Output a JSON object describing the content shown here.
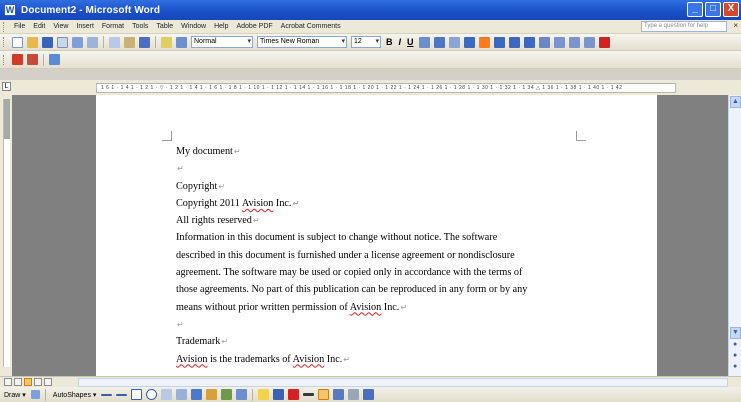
{
  "window": {
    "title": "Document2 - Microsoft Word",
    "app_icon": "W",
    "buttons": {
      "minimize": "_",
      "maximize": "□",
      "close": "X"
    }
  },
  "menubar": {
    "items": [
      "File",
      "Edit",
      "View",
      "Insert",
      "Format",
      "Tools",
      "Table",
      "Window",
      "Help",
      "Adobe PDF",
      "Acrobat Comments"
    ],
    "help_placeholder": "Type a question for help",
    "close_glyph": "×"
  },
  "formatting": {
    "style": "Normal",
    "font": "Times New Roman",
    "size": "12",
    "bold": "B",
    "italic": "I",
    "underline": "U"
  },
  "ruler": {
    "ticks": "1 6 1 · 1 4 1 · 1 2 1 · ▽ · 1 2 1 · 1 4 1 · 1 6 1 · 1 8 1 · 1 10 1 · 1 12 1 · 1 14 1 · 1 16 1 · 1 18 1 · 1 20 1 · 1 22 1 · 1 24 1 · 1 26 1 · 1 28 1 · 1 30 1 · 1 32 1 · 1 34 △ 1 36 1 · 1 38 1 · 1 40 1 · 1 42"
  },
  "document": {
    "para_mark": "↵",
    "lines": [
      "My document",
      "",
      "Copyright",
      "Copyright 2011 ",
      "All rights reserved",
      "Information in this document is subject to change without notice. The software",
      "described in this document is furnished under a license agreement or nondisclosure",
      "agreement. The software may be used or copied only in accordance with the terms of",
      "those agreements. No part of this publication can be reproduced in any form or by any",
      "means without prior written permission of ",
      "",
      "Trademark",
      ""
    ],
    "avision": "Avision",
    "inc_suffix": " Inc.",
    "trademark_mid": " is the trademarks of "
  },
  "drawbar": {
    "draw_label": "Draw ▾",
    "autoshapes_label": "AutoShapes ▾"
  },
  "colors": {
    "titlebar": "#1a4fc8",
    "highlight": "#f7c46a",
    "font_color": "#d22222"
  }
}
